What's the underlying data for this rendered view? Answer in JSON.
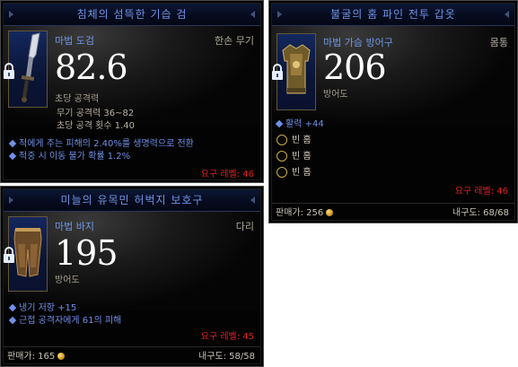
{
  "sword": {
    "title": "침체의 섬뜩한 기습 검",
    "item_type": "마법 도검",
    "slot": "한손 무기",
    "main_value": "82.6",
    "main_caption": "초당 공격력",
    "stats": [
      "무기 공격력 36~82",
      "초당 공격 횟수 1.40"
    ],
    "affixes": [
      "적에게 주는 피해의 2.40%를 생명력으로 전환",
      "적중 시 이동 불가 확률 1.2%"
    ],
    "required_level": "요구 레벨: 46",
    "icon": "lock-icon"
  },
  "pants": {
    "title": "미늘의 유목민 허벅지 보호구",
    "item_type": "마법 바지",
    "slot": "다리",
    "main_value": "195",
    "main_caption": "방어도",
    "affixes": [
      "냉기 저항 +15",
      "근접 공격자에게 61의 피해"
    ],
    "required_level": "요구 레벨: 45",
    "sell_label": "판매가: 165",
    "durability": "내구도: 58/58",
    "icon": "lock-icon"
  },
  "chest": {
    "title": "불굴의 홈 파인 전투 갑옷",
    "item_type": "마법 가슴 방어구",
    "slot": "몸통",
    "main_value": "206",
    "main_caption": "방어도",
    "affixes": [
      "활력 +44"
    ],
    "sockets": [
      "빈 홈",
      "빈 홈",
      "빈 홈"
    ],
    "required_level": "요구 레벨: 46",
    "sell_label": "판매가: 256",
    "durability": "내구도: 68/68",
    "icon": "lock-icon"
  },
  "colors": {
    "title_blue": "#6f93e6",
    "affix_blue": "#6f8fe8",
    "requirement_red": "#e0201e",
    "socket_gold": "#c9a94a"
  }
}
